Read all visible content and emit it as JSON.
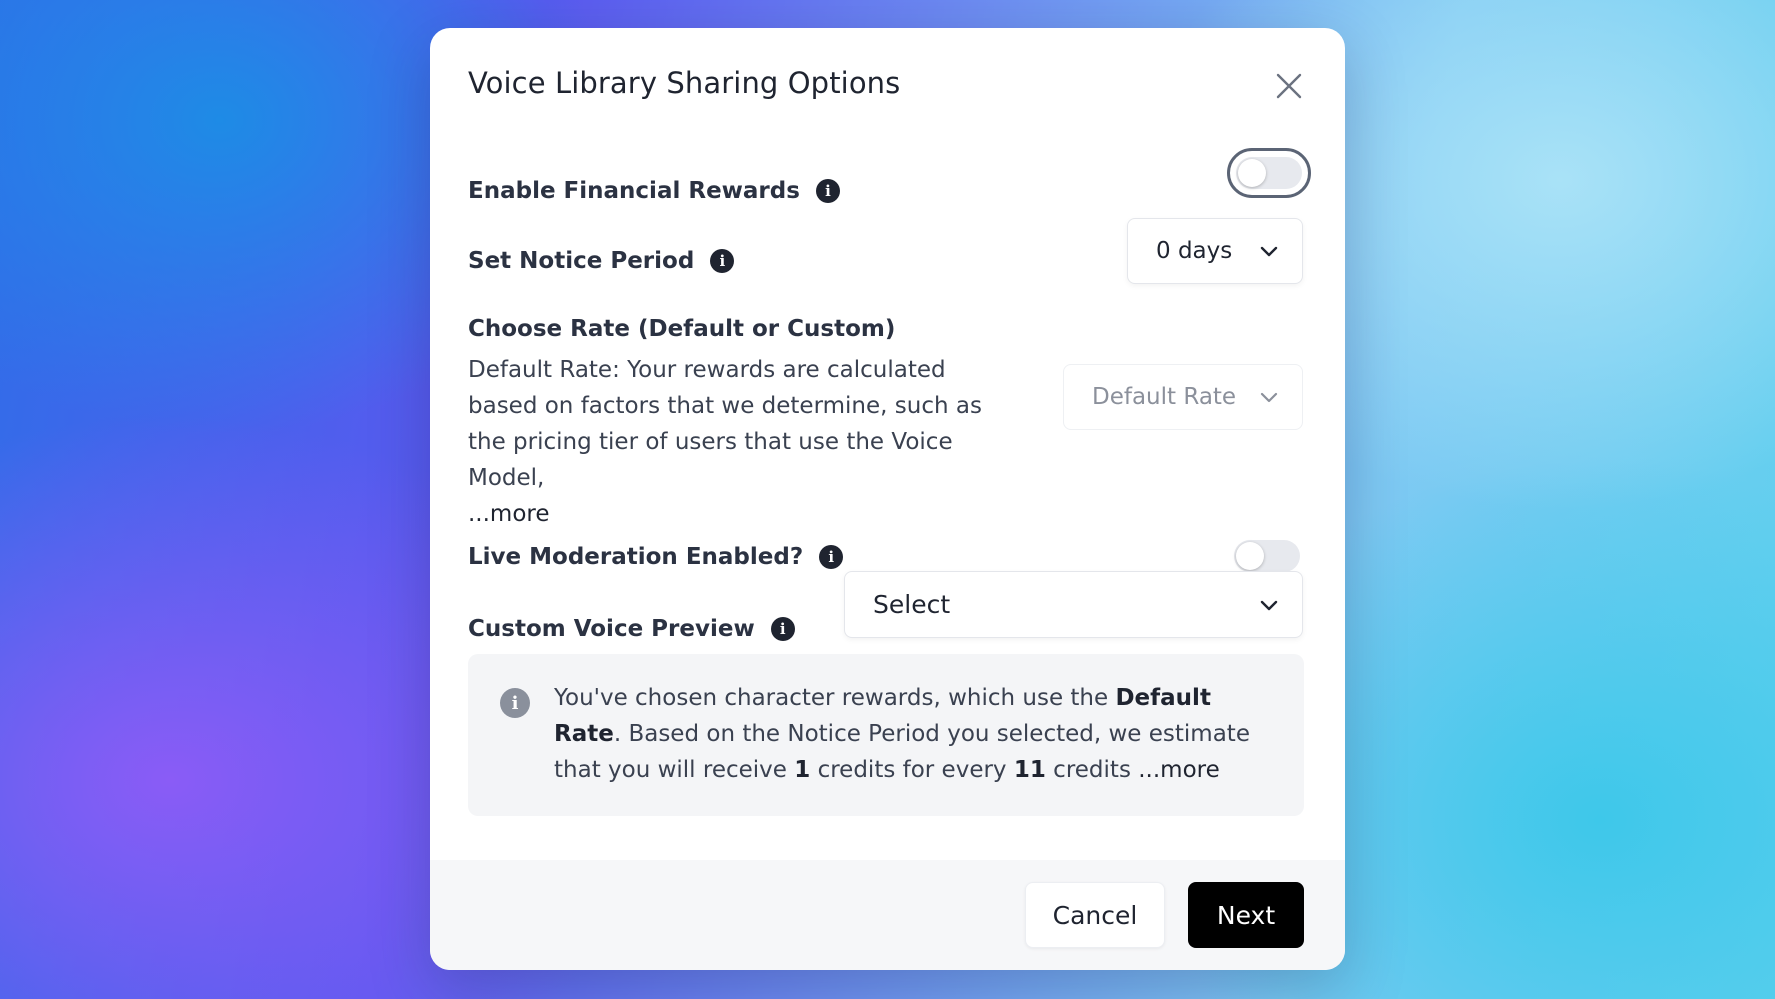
{
  "modal": {
    "title": "Voice Library Sharing Options",
    "close_icon": "close-icon"
  },
  "financial_rewards": {
    "label": "Enable Financial Rewards",
    "info_icon": "info-icon",
    "enabled": false
  },
  "notice_period": {
    "label": "Set Notice Period",
    "info_icon": "info-icon",
    "selected": "0 days"
  },
  "rate": {
    "label": "Choose Rate (Default or Custom)",
    "description": "Default Rate: Your rewards are calculated based on factors that we determine, such as the pricing tier of users that use the Voice Model,",
    "more_link": "...more",
    "selected": "Default Rate"
  },
  "live_moderation": {
    "label": "Live Moderation Enabled?",
    "info_icon": "info-icon",
    "enabled": false
  },
  "custom_voice_preview": {
    "label": "Custom Voice Preview",
    "info_icon": "info-icon",
    "selected": "Select"
  },
  "info_box": {
    "icon": "info-icon",
    "text_part1": "You've chosen character rewards, which use the ",
    "rate_name": "Default Rate",
    "text_part2": ". Based on the Notice Period you selected, we estimate that you will receive ",
    "credits_received": "1",
    "text_part3": " credits for every ",
    "credits_spent": "11",
    "text_part4": " credits ",
    "more_link": "...more"
  },
  "footer": {
    "cancel_label": "Cancel",
    "next_label": "Next"
  },
  "colors": {
    "primary_button": "#000000",
    "text": "#1f2430",
    "toggle_off": "#e7e9ee"
  }
}
